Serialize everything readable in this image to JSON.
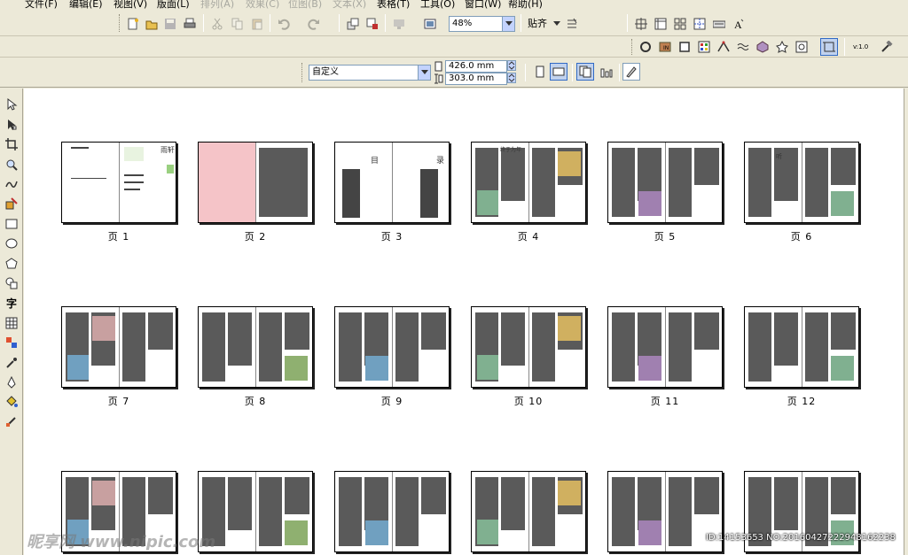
{
  "menu": [
    {
      "label": "文件(F)",
      "enabled": true
    },
    {
      "label": "编辑(E)",
      "enabled": true
    },
    {
      "label": "视图(V)",
      "enabled": true
    },
    {
      "label": "版面(L)",
      "enabled": true
    },
    {
      "label": "排列(A)",
      "enabled": false
    },
    {
      "label": "效果(C)",
      "enabled": false
    },
    {
      "label": "位图(B)",
      "enabled": false
    },
    {
      "label": "文本(X)",
      "enabled": false
    },
    {
      "label": "表格(T)",
      "enabled": true
    },
    {
      "label": "工具(O)",
      "enabled": true
    },
    {
      "label": "窗口(W)",
      "enabled": true
    },
    {
      "label": "帮助(H)",
      "enabled": true
    }
  ],
  "toolbar": {
    "zoom_value": "48%",
    "snap_label": "贴齐",
    "version_label": "v:1.0"
  },
  "property_bar": {
    "paper_preset": "自定义",
    "width_value": "426.0 mm",
    "height_value": "303.0 mm"
  },
  "pages": [
    {
      "label": "页 1"
    },
    {
      "label": "页 2"
    },
    {
      "label": "页 3"
    },
    {
      "label": "页 4"
    },
    {
      "label": "页 5"
    },
    {
      "label": "页 6"
    },
    {
      "label": "页 7"
    },
    {
      "label": "页 8"
    },
    {
      "label": "页 9"
    },
    {
      "label": "页 10"
    },
    {
      "label": "页 11"
    },
    {
      "label": "页 12"
    },
    {
      "label": ""
    },
    {
      "label": ""
    },
    {
      "label": ""
    },
    {
      "label": ""
    },
    {
      "label": ""
    },
    {
      "label": ""
    }
  ],
  "page_text": {
    "p1_title": "雨轩",
    "p3_left": "目",
    "p3_right": "录",
    "p4_title": "终于为年",
    "p6_title": "听"
  },
  "watermark": {
    "brand": "昵享网 www.nipic.com",
    "id_text": "ID:14153653 NO:20160427222948162238"
  },
  "colors": {
    "toolbar_bg": "#ece9d8",
    "canvas_bg": "#ffffff",
    "page_pink": "#f5c4c8",
    "accent_green": "#4a9a3a"
  }
}
